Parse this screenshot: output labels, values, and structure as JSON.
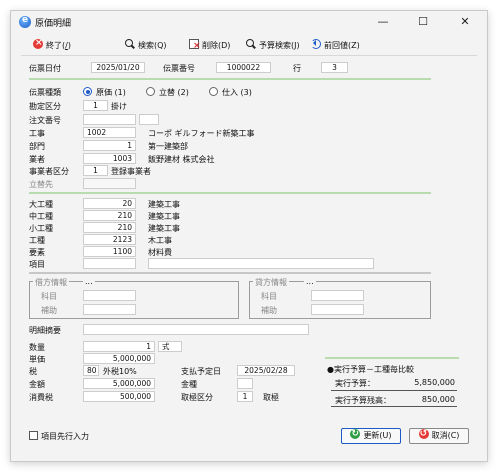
{
  "window": {
    "title": "原価明細",
    "minimize_glyph": "—",
    "maximize_glyph": "☐",
    "close_glyph": "✕"
  },
  "toolbar": {
    "exit_label": "終了(",
    "exit_key": "/",
    "exit_close": ")",
    "search_label": "検索(Q)",
    "delete_label": "削除(D)",
    "budget_search_label": "予算検索(J)",
    "prev_label": "前回値(Z)"
  },
  "header": {
    "date_label": "伝票日付",
    "date_value": "2025/01/20",
    "voucher_no_label": "伝票番号",
    "voucher_no_value": "1000022",
    "line_label": "行",
    "line_value": "3"
  },
  "entry_type": {
    "label": "伝票種類",
    "options": [
      {
        "label": "原価 (1)",
        "selected": true
      },
      {
        "label": "立替 (2)",
        "selected": false
      },
      {
        "label": "仕入 (3)",
        "selected": false
      }
    ]
  },
  "fields": {
    "account_kbn": {
      "label": "勘定区分",
      "code": "1",
      "name": "掛け"
    },
    "order_no": {
      "label": "注文番号",
      "value": ""
    },
    "construction": {
      "label": "工事",
      "code": "1002",
      "name": "コーポ ギルフォード新築工事"
    },
    "department": {
      "label": "部門",
      "code": "1",
      "name": "第一建築部"
    },
    "vendor": {
      "label": "業者",
      "code": "1003",
      "name": "飯野建材 株式会社"
    },
    "vendor_kbn": {
      "label": "事業者区分",
      "code": "1",
      "name": "登録事業者"
    },
    "advance_to": {
      "label": "立替先",
      "value": ""
    }
  },
  "categories": {
    "large": {
      "label": "大工種",
      "code": "20",
      "name": "建築工事"
    },
    "middle": {
      "label": "中工種",
      "code": "210",
      "name": "建築工事"
    },
    "small": {
      "label": "小工種",
      "code": "210",
      "name": "建築工事"
    },
    "work": {
      "label": "工種",
      "code": "2123",
      "name": "木工事"
    },
    "element": {
      "label": "要素",
      "code": "1100",
      "name": "材料費"
    },
    "item": {
      "label": "項目",
      "code": "",
      "name": ""
    }
  },
  "debit": {
    "title": "借方情報",
    "ellipsis": "...",
    "account_label": "科目",
    "sub_label": "補助"
  },
  "credit": {
    "title": "貸方情報",
    "ellipsis": "...",
    "account_label": "科目",
    "sub_label": "補助"
  },
  "summary": {
    "label": "明細摘要",
    "value": ""
  },
  "amounts": {
    "qty_label": "数量",
    "qty_value": "1",
    "unit_value": "式",
    "price_label": "単価",
    "price_value": "5,000,000",
    "tax_label": "税",
    "tax_code": "80",
    "tax_name": "外税10%",
    "amount_label": "金額",
    "amount_value": "5,000,000",
    "ctax_label": "消費税",
    "ctax_value": "500,000",
    "pay_date_label": "支払予定日",
    "pay_date_value": "2025/02/28",
    "kingaku_label": "金種",
    "kingaku_value": "",
    "txn_kbn_label": "取極区分",
    "txn_kbn_code": "1",
    "txn_kbn_name": "取極"
  },
  "budget": {
    "title": "●実行予算－工種毎比較",
    "exec_label": "実行予算：",
    "exec_value": "5,850,000",
    "remaining_label": "実行予算残高：",
    "remaining_value": "850,000"
  },
  "footer": {
    "prefill_label": "項目先行入力",
    "update_label": "更新(U)",
    "cancel_label": "取消(C)"
  }
}
